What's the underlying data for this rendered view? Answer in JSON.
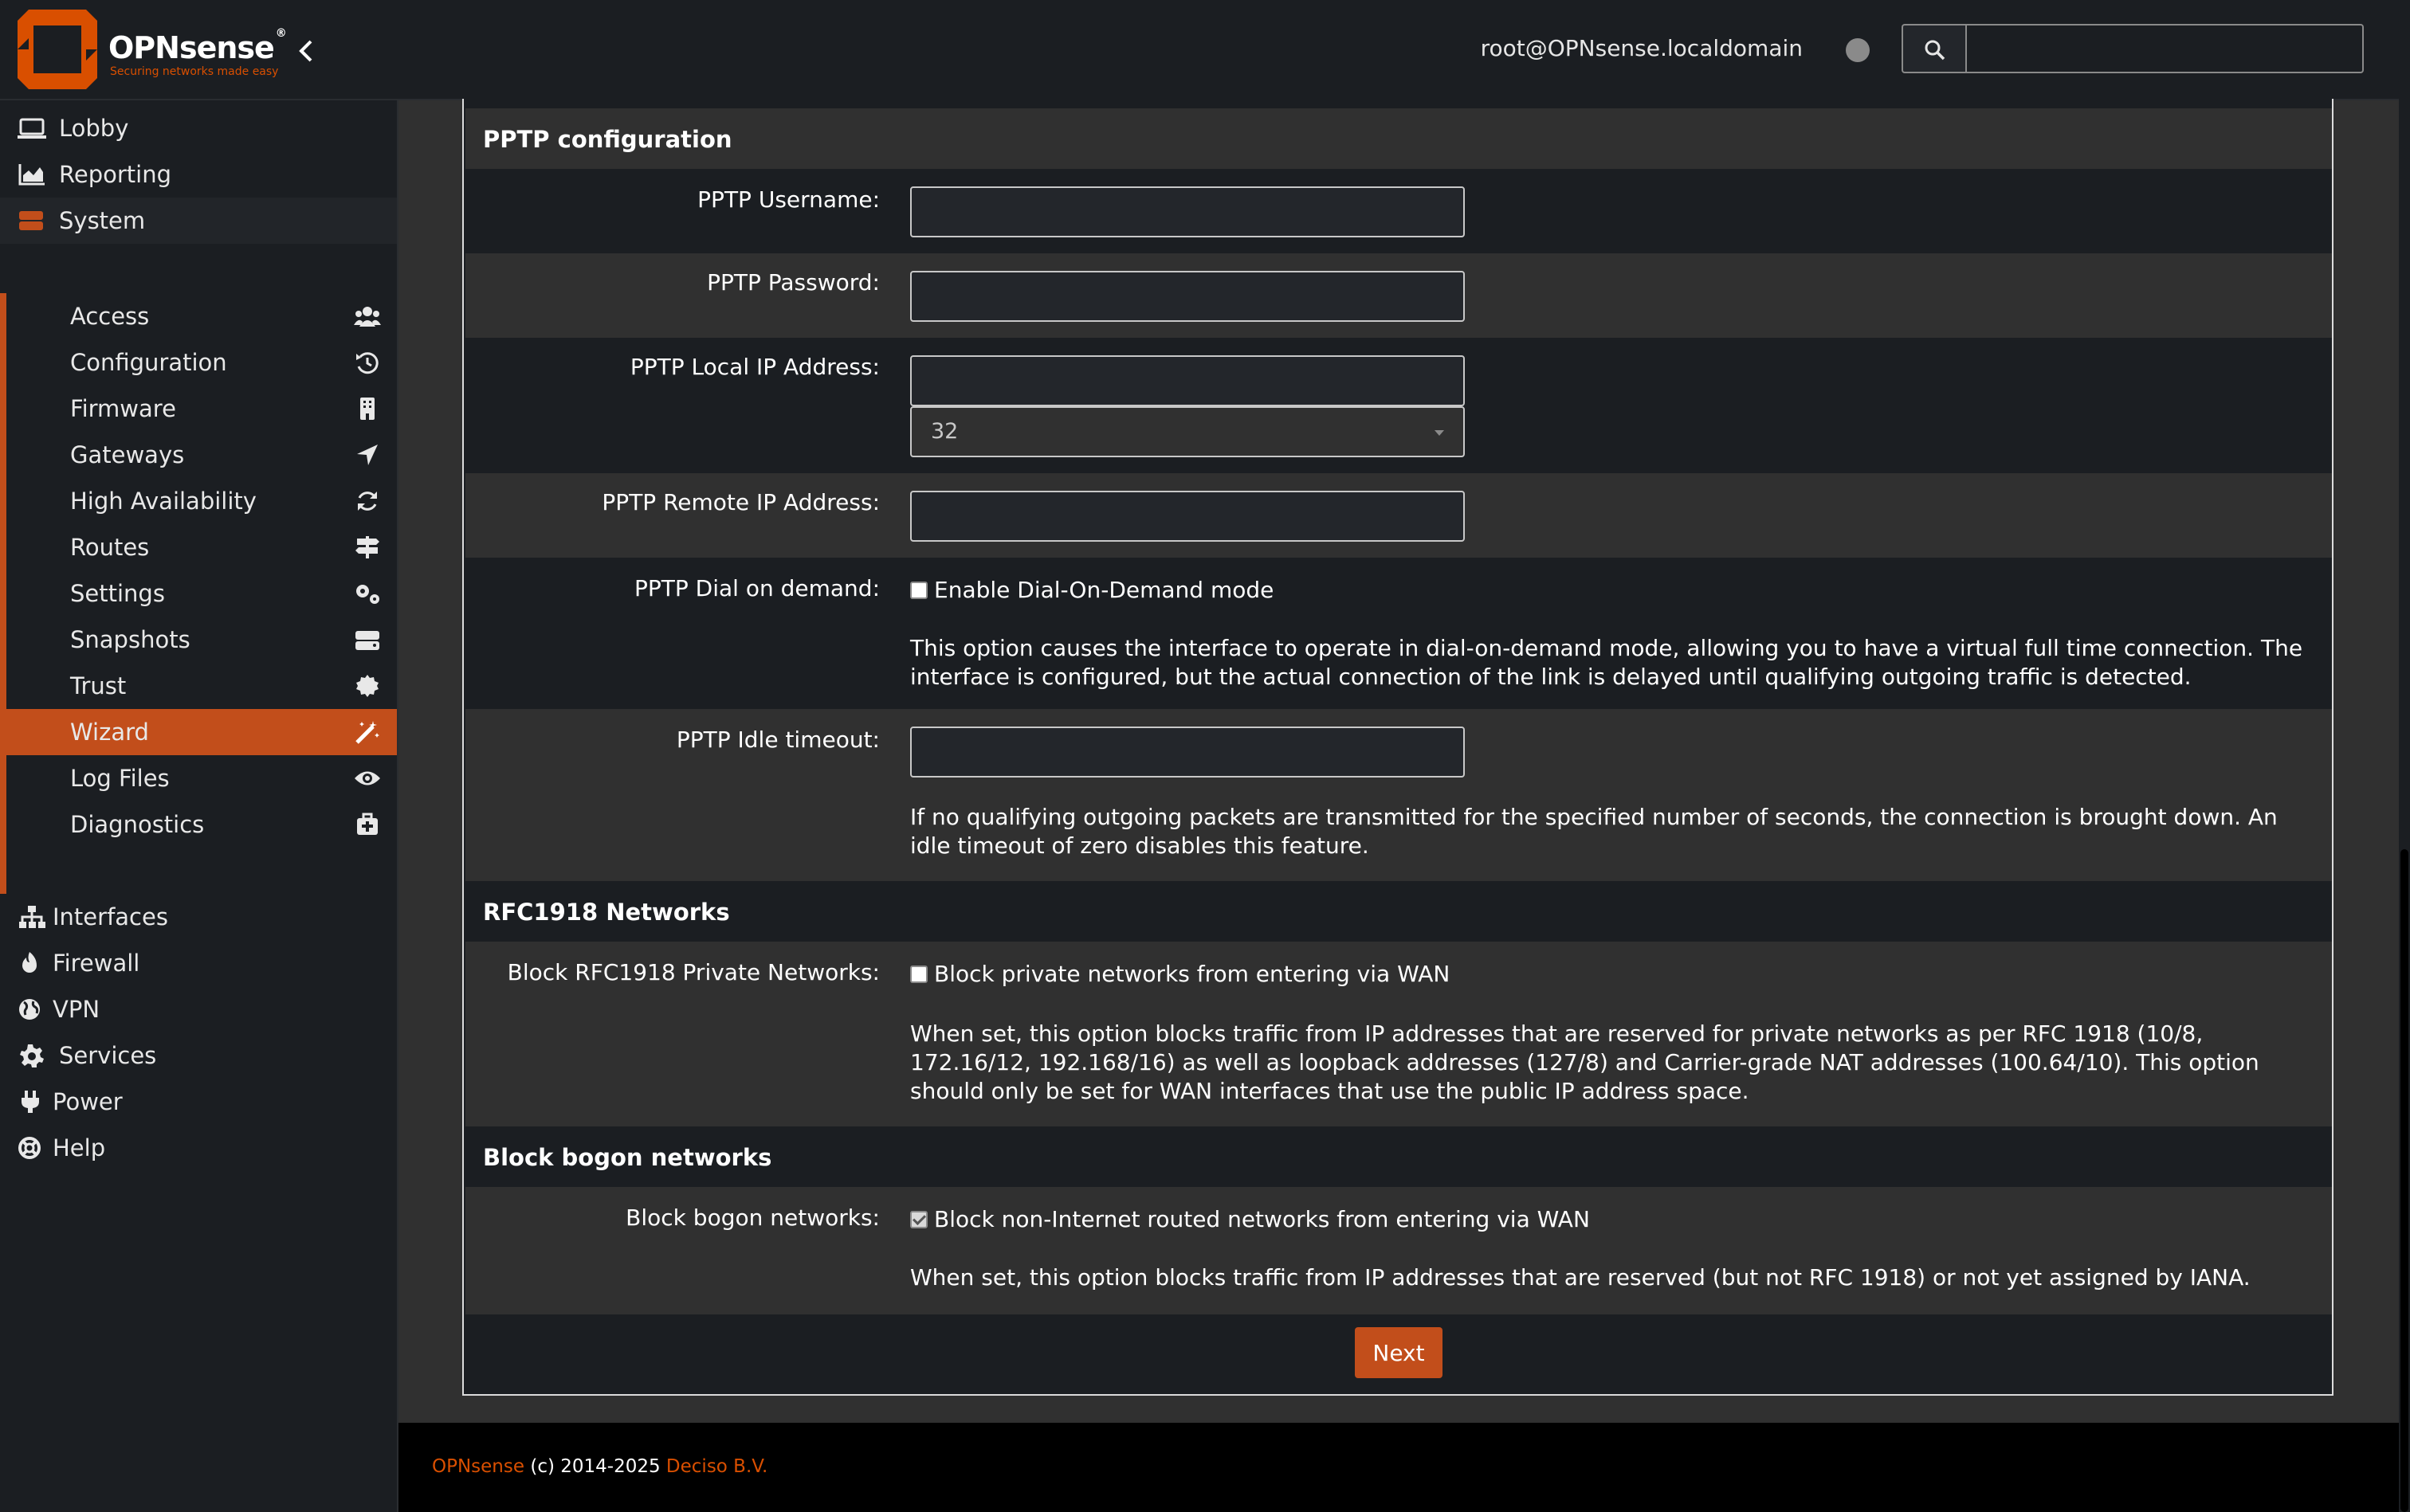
{
  "header": {
    "brand_name": "OPNsense",
    "brand_reg": "®",
    "tagline": "Securing networks made easy",
    "user": "root@OPNsense.localdomain",
    "search_placeholder": ""
  },
  "sidebar": {
    "items": [
      {
        "label": "Lobby",
        "icon": "laptop-icon"
      },
      {
        "label": "Reporting",
        "icon": "area-chart-icon"
      },
      {
        "label": "System",
        "icon": "server-icon"
      },
      {
        "label": "Interfaces",
        "icon": "sitemap-icon"
      },
      {
        "label": "Firewall",
        "icon": "fire-icon"
      },
      {
        "label": "VPN",
        "icon": "globe-icon"
      },
      {
        "label": "Services",
        "icon": "cog-icon"
      },
      {
        "label": "Power",
        "icon": "plug-icon"
      },
      {
        "label": "Help",
        "icon": "life-ring-icon"
      }
    ],
    "system_items": [
      {
        "label": "Access",
        "icon": "users-icon"
      },
      {
        "label": "Configuration",
        "icon": "history-icon"
      },
      {
        "label": "Firmware",
        "icon": "building-icon"
      },
      {
        "label": "Gateways",
        "icon": "location-arrow-icon"
      },
      {
        "label": "High Availability",
        "icon": "refresh-icon"
      },
      {
        "label": "Routes",
        "icon": "map-signs-icon"
      },
      {
        "label": "Settings",
        "icon": "cogs-icon"
      },
      {
        "label": "Snapshots",
        "icon": "hdd-icon"
      },
      {
        "label": "Trust",
        "icon": "certificate-icon"
      },
      {
        "label": "Wizard",
        "icon": "magic-wand-icon",
        "active": true
      },
      {
        "label": "Log Files",
        "icon": "eye-icon"
      },
      {
        "label": "Diagnostics",
        "icon": "medkit-icon"
      }
    ],
    "accent_color": "#c24e1b"
  },
  "pptp": {
    "section_title": "PPTP configuration",
    "username_label": "PPTP Username:",
    "username_value": "",
    "password_label": "PPTP Password:",
    "password_value": "",
    "local_ip_label": "PPTP Local IP Address:",
    "local_ip_value": "",
    "local_ip_subnet": "32",
    "remote_ip_label": "PPTP Remote IP Address:",
    "remote_ip_value": "",
    "dial_label": "PPTP Dial on demand:",
    "dial_checkbox_label": "Enable Dial-On-Demand mode",
    "dial_checked": false,
    "dial_help": "This option causes the interface to operate in dial-on-demand mode, allowing you to have a virtual full time connection. The interface is configured, but the actual connection of the link is delayed until qualifying outgoing traffic is detected.",
    "idle_label": "PPTP Idle timeout:",
    "idle_value": "",
    "idle_help": "If no qualifying outgoing packets are transmitted for the specified number of seconds, the connection is brought down. An idle timeout of zero disables this feature."
  },
  "rfc1918": {
    "section_title": "RFC1918 Networks",
    "label": "Block RFC1918 Private Networks:",
    "checkbox_label": "Block private networks from entering via WAN",
    "checked": false,
    "help": "When set, this option blocks traffic from IP addresses that are reserved for private networks as per RFC 1918 (10/8, 172.16/12, 192.168/16) as well as loopback addresses (127/8) and Carrier-grade NAT addresses (100.64/10). This option should only be set for WAN interfaces that use the public IP address space."
  },
  "bogon": {
    "section_title": "Block bogon networks",
    "label": "Block bogon networks:",
    "checkbox_label": "Block non-Internet routed networks from entering via WAN",
    "checked": true,
    "help": "When set, this option blocks traffic from IP addresses that are reserved (but not RFC 1918) or not yet assigned by IANA."
  },
  "actions": {
    "next_label": "Next"
  },
  "footer": {
    "brand": "OPNsense",
    "copyright": " (c) 2014-2025 ",
    "company": "Deciso B.V."
  }
}
